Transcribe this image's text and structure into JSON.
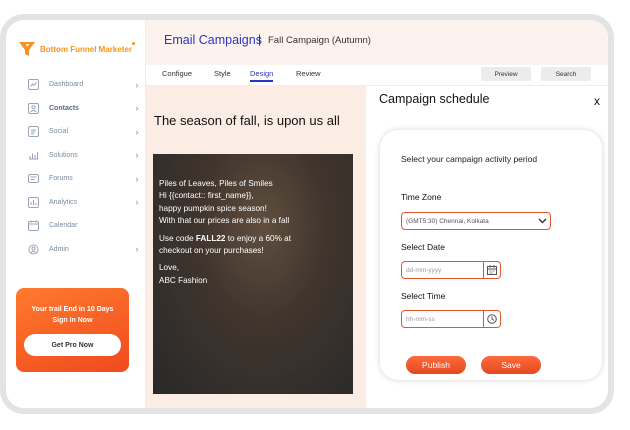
{
  "brand": {
    "name": "Bottom Funnel Marketer",
    "accent": "#f7931e"
  },
  "sidebar": {
    "items": [
      {
        "label": "Dashboard",
        "icon": "chart-icon",
        "chevron": true
      },
      {
        "label": "Contacts",
        "icon": "contacts-icon",
        "chevron": true,
        "active": true
      },
      {
        "label": "Social",
        "icon": "social-icon",
        "chevron": true
      },
      {
        "label": "Solutions",
        "icon": "solutions-icon",
        "chevron": true
      },
      {
        "label": "Forums",
        "icon": "forums-icon",
        "chevron": true
      },
      {
        "label": "Analytics",
        "icon": "analytics-icon",
        "chevron": true
      },
      {
        "label": "Calendar",
        "icon": "calendar-icon",
        "chevron": false
      },
      {
        "label": "Admin",
        "icon": "admin-icon",
        "chevron": true
      }
    ],
    "promo": {
      "line1": "Your trail End in 10 Days",
      "line2": "Sign In Now",
      "button": "Get Pro Now"
    }
  },
  "header": {
    "title": "Email Campaigns",
    "separator": "|",
    "subtitle": "Fall Campaign (Autumn)"
  },
  "tabs": {
    "configure": "Configue",
    "style": "Style",
    "design": "Design",
    "review": "Review"
  },
  "toolbar": {
    "preview": "Preview",
    "search": "Search"
  },
  "preview": {
    "heading": "The season of fall, is upon us all",
    "lines": {
      "l1": "Piles of Leaves, Piles of Smiles",
      "l2": "Hi {{contact:: first_name}},",
      "l3": "happy pumpkin spice season!",
      "l4": "With that our prices are also in a fall",
      "l5_pre": "Use code ",
      "l5_code": "FALL22",
      "l5_post": " to enjoy a 60% at",
      "l6": "checkout on your purchases!",
      "l7": "Love,",
      "l8": "ABC Fashion"
    }
  },
  "schedule": {
    "title": "Campaign schedule",
    "close": "x",
    "lead": "Select your campaign activity period",
    "timezone": {
      "label": "Time Zone",
      "value": "(GMT5:30) Chennai, Kolkata"
    },
    "date": {
      "label": "Select Date",
      "placeholder": "dd-mm-yyyy"
    },
    "time": {
      "label": "Select Time",
      "placeholder": "hh-mm-ss"
    },
    "publish": "Publish",
    "save": "Save"
  }
}
